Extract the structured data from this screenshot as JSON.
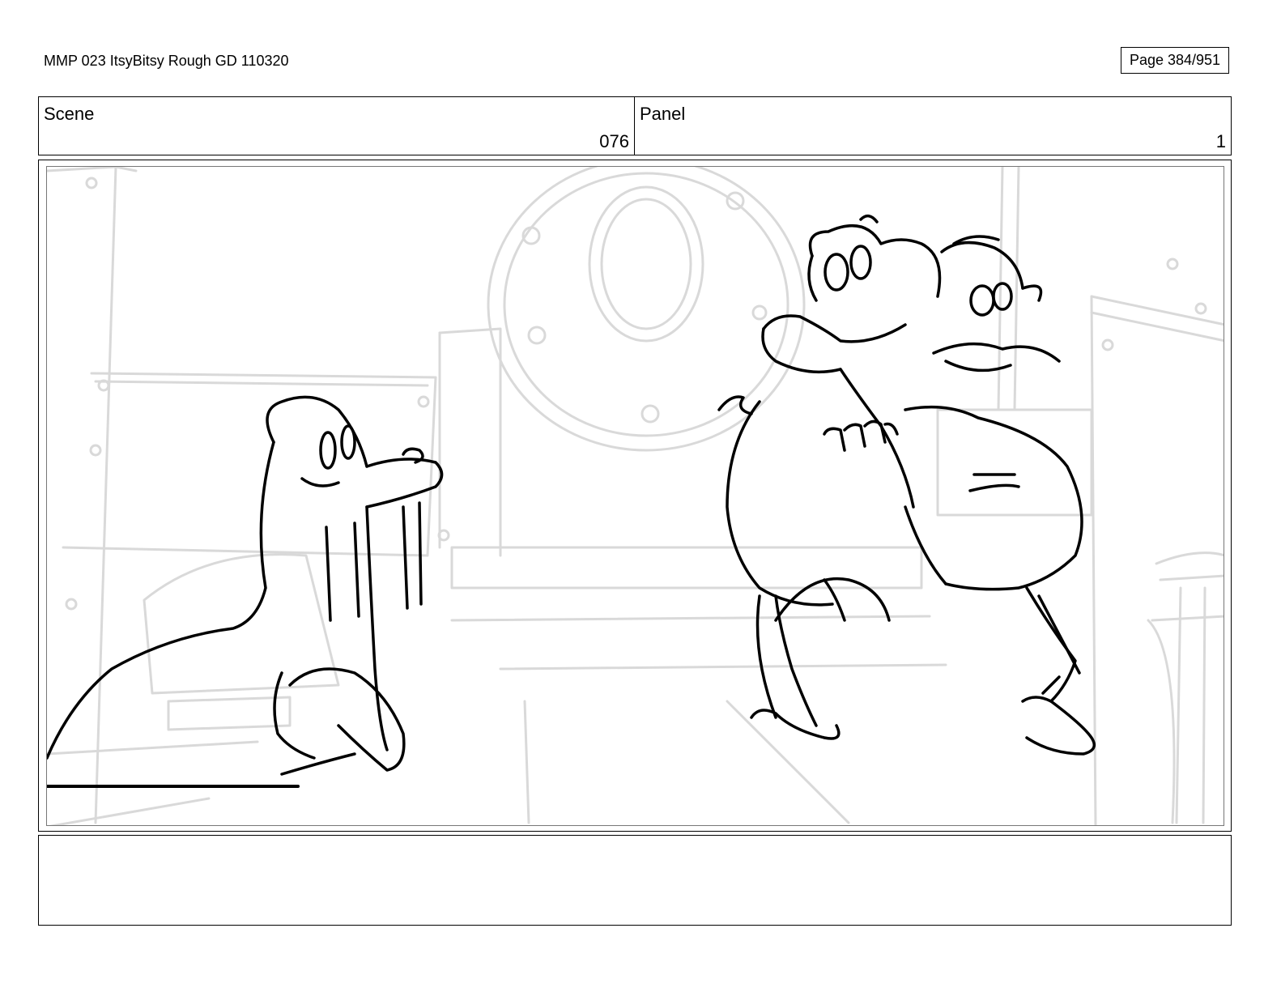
{
  "header": {
    "document_title": "MMP 023 ItsyBitsy Rough GD 110320",
    "page_label": "Page 384/951"
  },
  "info": {
    "scene_label": "Scene",
    "scene_value": "076",
    "panel_label": "Panel",
    "panel_value": "1"
  },
  "artwork": {
    "description_icon": "storyboard-sketch",
    "background_color": "#d9d9d9",
    "line_color": "#000000"
  },
  "notes": {
    "text": ""
  }
}
